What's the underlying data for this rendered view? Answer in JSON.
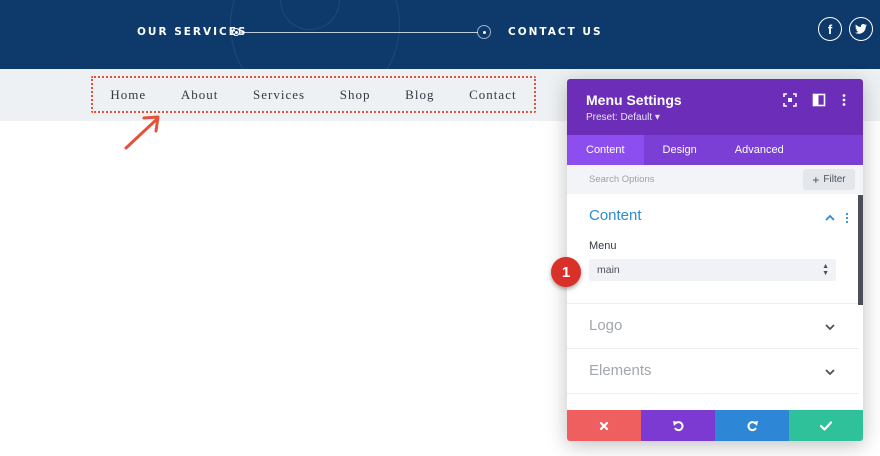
{
  "top_header": {
    "link_services": "OUR SERVICES",
    "link_contact": "CONTACT US",
    "social": {
      "facebook": "f",
      "twitter_icon": "twitter-icon"
    }
  },
  "menu": {
    "items": [
      "Home",
      "About",
      "Services",
      "Shop",
      "Blog",
      "Contact"
    ]
  },
  "panel": {
    "title": "Menu Settings",
    "preset": "Preset: Default ▾",
    "tabs": [
      "Content",
      "Design",
      "Advanced"
    ],
    "active_tab": "Content",
    "search_placeholder": "Search Options",
    "filter_label": "Filter",
    "sections": {
      "content": {
        "title": "Content",
        "field_label": "Menu",
        "select_value": "main"
      },
      "logo": {
        "title": "Logo"
      },
      "elements": {
        "title": "Elements"
      }
    },
    "footer": [
      "cancel-icon",
      "undo-icon",
      "redo-icon",
      "check-icon"
    ]
  },
  "annotation": {
    "step": "1"
  },
  "colors": {
    "header_bg": "#0d3a6b",
    "panel_purple": "#6c2eb9",
    "highlight_red": "#e2533c",
    "cancel": "#ef5f5f",
    "undo": "#7d3ad3",
    "redo": "#2e86d6",
    "save": "#2fc29a"
  }
}
